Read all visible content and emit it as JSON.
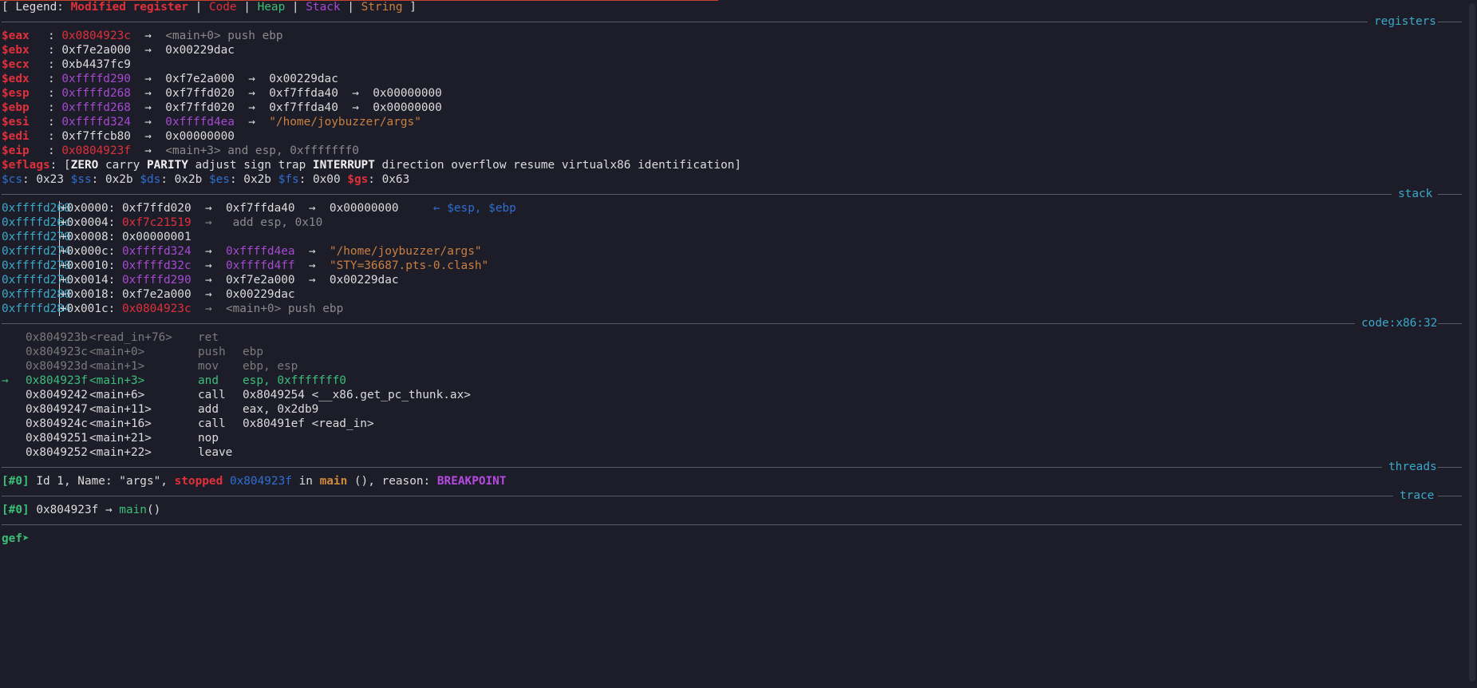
{
  "legend": {
    "open": "[ Legend: ",
    "modified": "Modified register",
    "code": "Code",
    "heap": "Heap",
    "stack": "Stack",
    "string": "String",
    "sep": " | ",
    "close": " ]"
  },
  "sections": {
    "registers": "registers",
    "stack": "stack",
    "code": "code:x86:32",
    "threads": "threads",
    "trace": "trace"
  },
  "registers": [
    {
      "name": "$eax",
      "value": "0x0804923c",
      "chain": "  →  <main+0> push ebp"
    },
    {
      "name": "$ebx",
      "value": "0xf7e2a000",
      "chain": "  →  0x00229dac"
    },
    {
      "name": "$ecx",
      "value": "0xb4437fc9",
      "chain": ""
    },
    {
      "name": "$edx",
      "value": "0xffffd290",
      "chain": "  →  0xf7e2a000  →  0x00229dac"
    },
    {
      "name": "$esp",
      "value": "0xffffd268",
      "chain": "  →  0xf7ffd020  →  0xf7ffda40  →  0x00000000"
    },
    {
      "name": "$ebp",
      "value": "0xffffd268",
      "chain": "  →  0xf7ffd020  →  0xf7ffda40  →  0x00000000"
    },
    {
      "name": "$esi",
      "value": "0xffffd324",
      "chain2": "0xffffd4ea",
      "chain3": "\"/home/joybuzzer/args\""
    },
    {
      "name": "$edi",
      "value": "0xf7ffcb80",
      "chain": "  →  0x00000000"
    },
    {
      "name": "$eip",
      "value": "0x0804923f",
      "chain": "  →  <main+3> and esp, 0xfffffff0"
    }
  ],
  "eflags": {
    "name": "$eflags",
    "open": ": [",
    "zero": "ZERO",
    "carry": " carry ",
    "parity": "PARITY",
    "mid": " adjust sign trap ",
    "interrupt": "INTERRUPT",
    "rest": " direction overflow resume virtualx86 identification]"
  },
  "segments": [
    {
      "name": "$cs",
      "val": "0x23"
    },
    {
      "name": "$ss",
      "val": "0x2b"
    },
    {
      "name": "$ds",
      "val": "0x2b"
    },
    {
      "name": "$es",
      "val": "0x2b"
    },
    {
      "name": "$fs",
      "val": "0x00"
    },
    {
      "name": "$gs",
      "val": "0x63"
    }
  ],
  "stack": [
    {
      "addr": "0xffffd268",
      "off": "+0x0000: ",
      "v1": "0xf7ffd020",
      "rest": "  →  0xf7ffda40  →  0x00000000",
      "note": "← $esp, $ebp"
    },
    {
      "addr": "0xffffd26c",
      "off": "+0x0004: ",
      "v1": "0xf7c21519",
      "rest": "  →   add esp, 0x10"
    },
    {
      "addr": "0xffffd270",
      "off": "+0x0008: ",
      "v1": "0x00000001",
      "rest": ""
    },
    {
      "addr": "0xffffd274",
      "off": "+0x000c: ",
      "v1": "0xffffd324",
      "v2": "0xffffd4ea",
      "str": "\"/home/joybuzzer/args\""
    },
    {
      "addr": "0xffffd278",
      "off": "+0x0010: ",
      "v1": "0xffffd32c",
      "v2": "0xffffd4ff",
      "str": "\"STY=36687.pts-0.clash\""
    },
    {
      "addr": "0xffffd27c",
      "off": "+0x0014: ",
      "v1": "0xffffd290",
      "rest": "  →  0xf7e2a000  →  0x00229dac"
    },
    {
      "addr": "0xffffd280",
      "off": "+0x0018: ",
      "v1": "0xf7e2a000",
      "rest": "  →  0x00229dac"
    },
    {
      "addr": "0xffffd284",
      "off": "+0x001c: ",
      "v1": "0x0804923c",
      "rest": "  →  <main+0> push ebp"
    }
  ],
  "code": [
    {
      "arrow": "",
      "addr": "0x804923b",
      "sym": "<read_in+76>",
      "mn": "ret",
      "op": "",
      "state": "past"
    },
    {
      "arrow": "",
      "addr": "0x804923c",
      "sym": "<main+0>",
      "mn": "push",
      "op": "ebp",
      "state": "past"
    },
    {
      "arrow": "",
      "addr": "0x804923d",
      "sym": "<main+1>",
      "mn": "mov",
      "op": "ebp, esp",
      "state": "past"
    },
    {
      "arrow": "→",
      "addr": "0x804923f",
      "sym": "<main+3>",
      "mn": "and",
      "op": "esp, 0xfffffff0",
      "state": "current"
    },
    {
      "arrow": "",
      "addr": "0x8049242",
      "sym": "<main+6>",
      "mn": "call",
      "op": "0x8049254 <__x86.get_pc_thunk.ax>",
      "state": "next"
    },
    {
      "arrow": "",
      "addr": "0x8049247",
      "sym": "<main+11>",
      "mn": "add",
      "op": "eax, 0x2db9",
      "state": "next"
    },
    {
      "arrow": "",
      "addr": "0x804924c",
      "sym": "<main+16>",
      "mn": "call",
      "op": "0x80491ef <read_in>",
      "state": "next"
    },
    {
      "arrow": "",
      "addr": "0x8049251",
      "sym": "<main+21>",
      "mn": "nop",
      "op": "",
      "state": "next"
    },
    {
      "arrow": "",
      "addr": "0x8049252",
      "sym": "<main+22>",
      "mn": "leave",
      "op": "",
      "state": "next"
    }
  ],
  "thread": {
    "idx": "[#0]",
    "text1": " Id 1, Name: \"args\", ",
    "state": "stopped",
    "addr": "0x804923f",
    "in": " in ",
    "func": "main",
    "text2": " (), reason: ",
    "reason": "BREAKPOINT"
  },
  "trace": {
    "idx": "[#0]",
    "addr": " 0x804923f → ",
    "func": "main",
    "paren": "()"
  },
  "prompt": "gef➤"
}
